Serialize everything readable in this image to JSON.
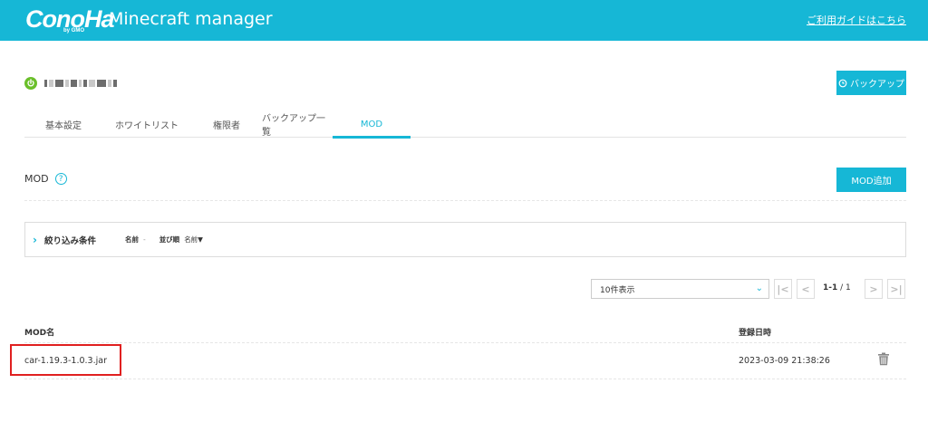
{
  "header": {
    "logo_text": "ConoHa",
    "logo_sub": "by GMO",
    "app_title": "Minecraft manager",
    "guide_link": "ご利用ガイドはこちら"
  },
  "server": {
    "backup_button": "バックアップ"
  },
  "tabs": [
    {
      "label": "基本設定",
      "active": false
    },
    {
      "label": "ホワイトリスト",
      "active": false
    },
    {
      "label": "権限者",
      "active": false
    },
    {
      "label": "バックアップ一覧",
      "active": false
    },
    {
      "label": "MOD",
      "active": true
    }
  ],
  "section": {
    "title": "MOD",
    "help": "?",
    "add_button": "MOD追加"
  },
  "filter": {
    "title": "絞り込み条件",
    "name_label": "名前",
    "name_value": "-",
    "sort_label": "並び順",
    "sort_value": "名前▼"
  },
  "pagination": {
    "per_page": "10件表示",
    "current": "1-1",
    "total": "/ 1",
    "first": "|<",
    "prev": "<",
    "next": ">",
    "last": ">|"
  },
  "table": {
    "columns": [
      "MOD名",
      "登録日時"
    ],
    "rows": [
      {
        "name": "car-1.19.3-1.0.3.jar",
        "date": "2023-03-09 21:38:26"
      }
    ]
  },
  "colors": {
    "accent": "#16b7d6",
    "status_on": "#6abf2a",
    "highlight": "#e02020"
  }
}
